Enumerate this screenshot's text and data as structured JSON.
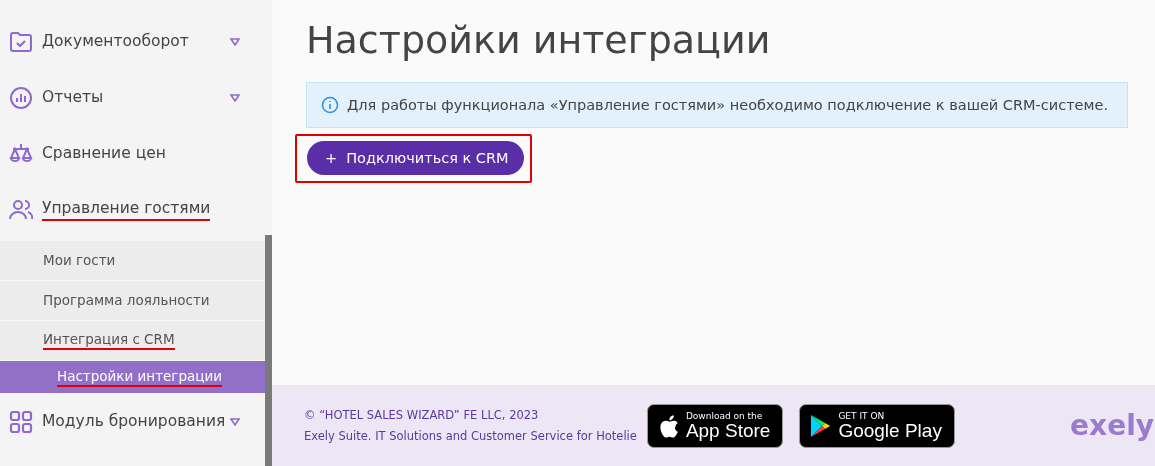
{
  "sidebar": {
    "items": [
      {
        "label": "Документооборот",
        "kind": "folder",
        "has_caret": true,
        "marked": false
      },
      {
        "label": "Отчеты",
        "kind": "chart",
        "has_caret": true,
        "marked": false
      },
      {
        "label": "Сравнение цен",
        "kind": "scales",
        "has_caret": false,
        "marked": false
      },
      {
        "label": "Управление гостями",
        "kind": "people",
        "has_caret": false,
        "marked": true,
        "children": [
          {
            "label": "Мои гости",
            "selected": false,
            "marked": false
          },
          {
            "label": "Программа лояльности",
            "selected": false,
            "marked": false
          },
          {
            "label": "Интеграция с CRM",
            "selected": false,
            "marked": true
          },
          {
            "label": "Настройки интеграции",
            "selected": true,
            "marked": true
          }
        ]
      },
      {
        "label": "Модуль бронирования",
        "kind": "grid",
        "has_caret": true,
        "marked": false
      }
    ]
  },
  "main": {
    "title": "Настройки интеграции",
    "info": "Для работы функционала «Управление гостями» необходимо подключение к вашей CRM-системе.",
    "button": {
      "icon": "+",
      "label": "Подключиться к CRM",
      "marked": true
    }
  },
  "footer": {
    "copyright": "© “HOTEL SALES WIZARD” FE LLC, 2023",
    "tagline": "Exely Suite. IT Solutions and Customer Service for Hotelie",
    "badges": [
      {
        "kind": "apple",
        "small": "Download on the",
        "big": "App Store"
      },
      {
        "kind": "google",
        "small": "GET IT ON",
        "big": "Google Play"
      }
    ],
    "logo": "exely"
  }
}
